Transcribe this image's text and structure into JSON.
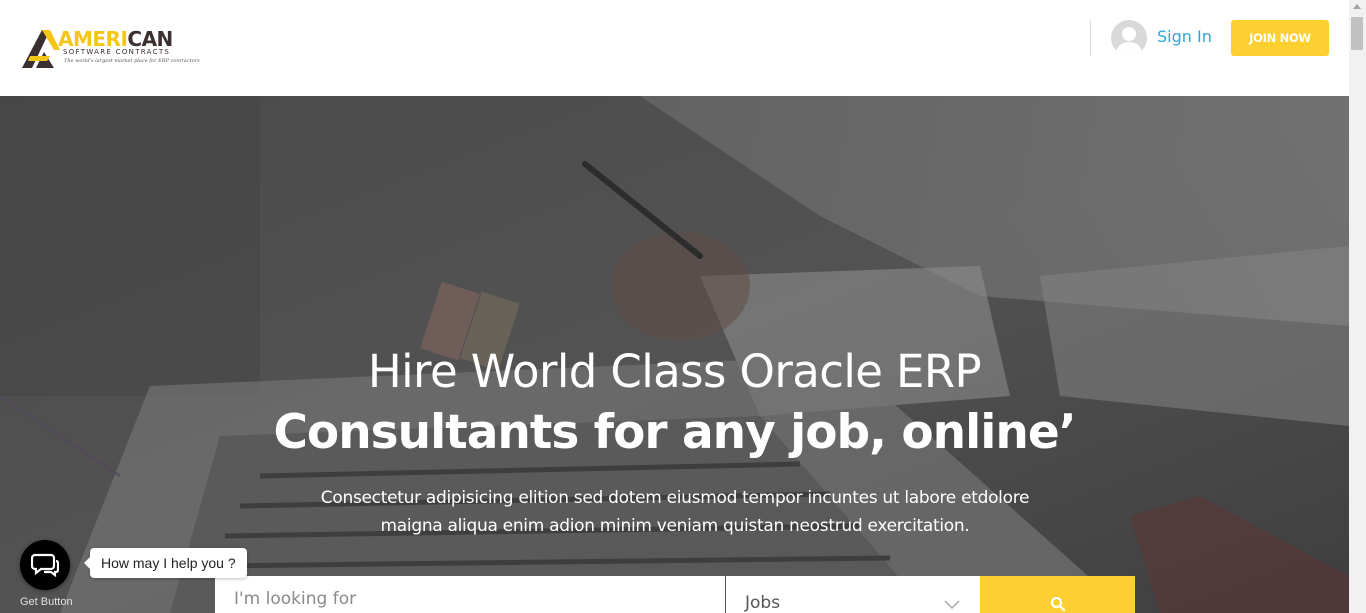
{
  "header": {
    "logo": {
      "word_part1": "AMERI",
      "word_part2": "CAN",
      "subtitle": "SOFTWARE CONTRACTS",
      "tagline": "The world's largest market place for ERP contractors"
    },
    "signin_label": "Sign In",
    "join_label": "JOIN NOW"
  },
  "hero": {
    "title_line1": "Hire World Class Oracle ERP",
    "title_line2": "Consultants for any job, online’",
    "subtitle": "Consectetur adipisicing elition sed dotem eiusmod tempor incuntes ut labore etdolore maigna aliqua enim adion minim veniam quistan neostrud exercitation."
  },
  "search": {
    "placeholder": "I'm looking for",
    "category_selected": "Jobs",
    "button_icon": "search-icon"
  },
  "chat": {
    "prompt": "How may I help you ?",
    "button_caption": "Get Button",
    "icon": "chat-bubbles-icon"
  },
  "colors": {
    "accent_yellow": "#fecf31",
    "link_blue": "#2ea6d9",
    "logo_dark": "#3b2f2f"
  }
}
